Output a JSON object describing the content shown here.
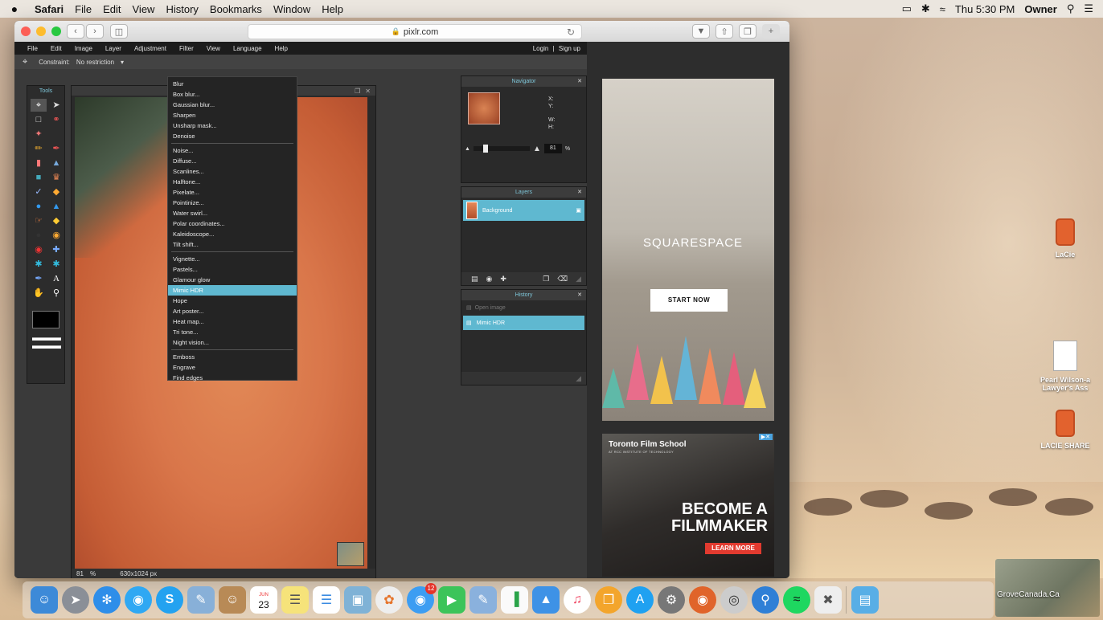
{
  "menubar": {
    "app": "Safari",
    "items": [
      "File",
      "Edit",
      "View",
      "History",
      "Bookmarks",
      "Window",
      "Help"
    ],
    "clock": "Thu 5:30 PM",
    "user": "Owner"
  },
  "browser": {
    "url": "pixlr.com"
  },
  "pixlr": {
    "menu": [
      "File",
      "Edit",
      "Image",
      "Layer",
      "Adjustment",
      "Filter",
      "View",
      "Language",
      "Help"
    ],
    "login": "Login",
    "separator": "|",
    "signup": "Sign up",
    "constraint_label": "Constraint:",
    "constraint_value": "No restriction",
    "tools_title": "Tools",
    "canvas_zoom": "81",
    "canvas_pct": "%",
    "canvas_size": "630x1024 px",
    "filter_menu": {
      "group1": [
        "Blur",
        "Box blur...",
        "Gaussian blur...",
        "Sharpen",
        "Unsharp mask...",
        "Denoise"
      ],
      "group2": [
        "Noise...",
        "Diffuse...",
        "Scanlines...",
        "Halftone...",
        "Pixelate...",
        "Pointinize...",
        "Water swirl...",
        "Polar coordinates...",
        "Kaleidoscope...",
        "Tilt shift..."
      ],
      "group3": [
        "Vignette...",
        "Pastels...",
        "Glamour glow",
        "Mimic HDR",
        "Hope",
        "Art poster...",
        "Heat map...",
        "Tri tone...",
        "Night vision..."
      ],
      "group4": [
        "Emboss",
        "Engrave",
        "Find edges"
      ],
      "selected": "Mimic HDR"
    },
    "navigator": {
      "title": "Navigator",
      "x": "X:",
      "y": "Y:",
      "w": "W:",
      "h": "H:",
      "zoom": "81",
      "pct": "%"
    },
    "layers": {
      "title": "Layers",
      "items": [
        "Background"
      ]
    },
    "history": {
      "title": "History",
      "items": [
        "Open image",
        "Mimic HDR"
      ]
    }
  },
  "ads": {
    "squarespace": {
      "brand": "SQUARESPACE",
      "cta": "START NOW"
    },
    "film": {
      "title": "Toronto Film School",
      "subtitle": "AT RCC INSTITUTE OF TECHNOLOGY",
      "headline1": "BECOME A",
      "headline2": "FILMMAKER",
      "cta": "LEARN MORE"
    }
  },
  "desktop": {
    "icons": [
      "LaCie",
      "Pearl Wilson-a Lawyer's Ass",
      "LACIE SHARE"
    ],
    "image_label": "GroveCanada.Ca"
  },
  "dock": {
    "calendar_month": "JUN",
    "calendar_day": "23",
    "messages_badge": "12"
  }
}
